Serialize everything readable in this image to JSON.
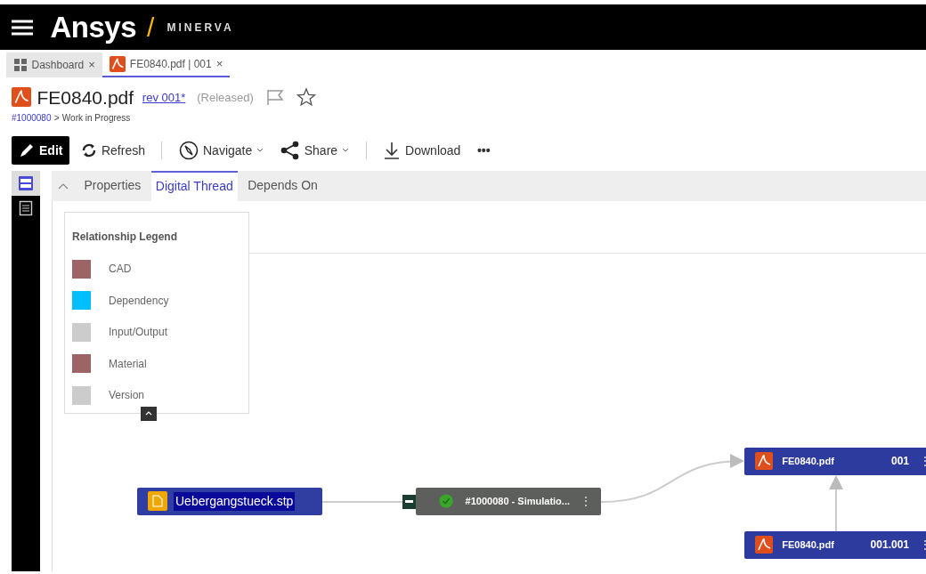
{
  "header": {
    "brand": "Ansys",
    "separator": "/",
    "product": "MINERVA"
  },
  "tabs": [
    {
      "label": "Dashboard",
      "close": "×",
      "selected": false
    },
    {
      "label": "FE0840.pdf | 001",
      "close": "×",
      "selected": true
    }
  ],
  "document": {
    "title": "FE0840.pdf",
    "revision": "rev 001*",
    "status": "(Released)",
    "breadcrumb": {
      "link": "#1000080",
      "separator": ">",
      "current": "Work in Progress"
    }
  },
  "toolbar": [
    {
      "kind": "primary",
      "label": "Edit"
    },
    {
      "kind": "button",
      "label": "Refresh"
    },
    {
      "kind": "separator"
    },
    {
      "kind": "dropdown",
      "label": "Navigate"
    },
    {
      "kind": "dropdown",
      "label": "Share"
    },
    {
      "kind": "separator"
    },
    {
      "kind": "button",
      "label": "Download"
    },
    {
      "kind": "more",
      "label": "•••"
    }
  ],
  "sidebar": [
    {
      "selected": true
    },
    {
      "selected": false
    }
  ],
  "panel_tabs": [
    {
      "label": "Properties",
      "selected": false
    },
    {
      "label": "Digital Thread",
      "selected": true
    },
    {
      "label": "Depends On",
      "selected": false
    }
  ],
  "legend": {
    "title": "Relationship Legend",
    "items": [
      {
        "label": "CAD",
        "color": "#9c6464"
      },
      {
        "label": "Dependency",
        "color": "#00bfff"
      },
      {
        "label": "Input/Output",
        "color": "#cccccc"
      },
      {
        "label": "Material",
        "color": "#9c6464"
      },
      {
        "label": "Version",
        "color": "#cccccc"
      }
    ]
  },
  "nodes": [
    {
      "kind": "file",
      "name": "Uebergangstueck.stp",
      "selected": true
    },
    {
      "kind": "task",
      "name": "#1000080 - Simulatio...",
      "menu": "⋮"
    },
    {
      "kind": "pdf",
      "name": "FE0840.pdf",
      "version": "001",
      "menu": "⋮"
    },
    {
      "kind": "pdf",
      "name": "FE0840.pdf",
      "version": "001.001",
      "menu": "⋮"
    }
  ]
}
